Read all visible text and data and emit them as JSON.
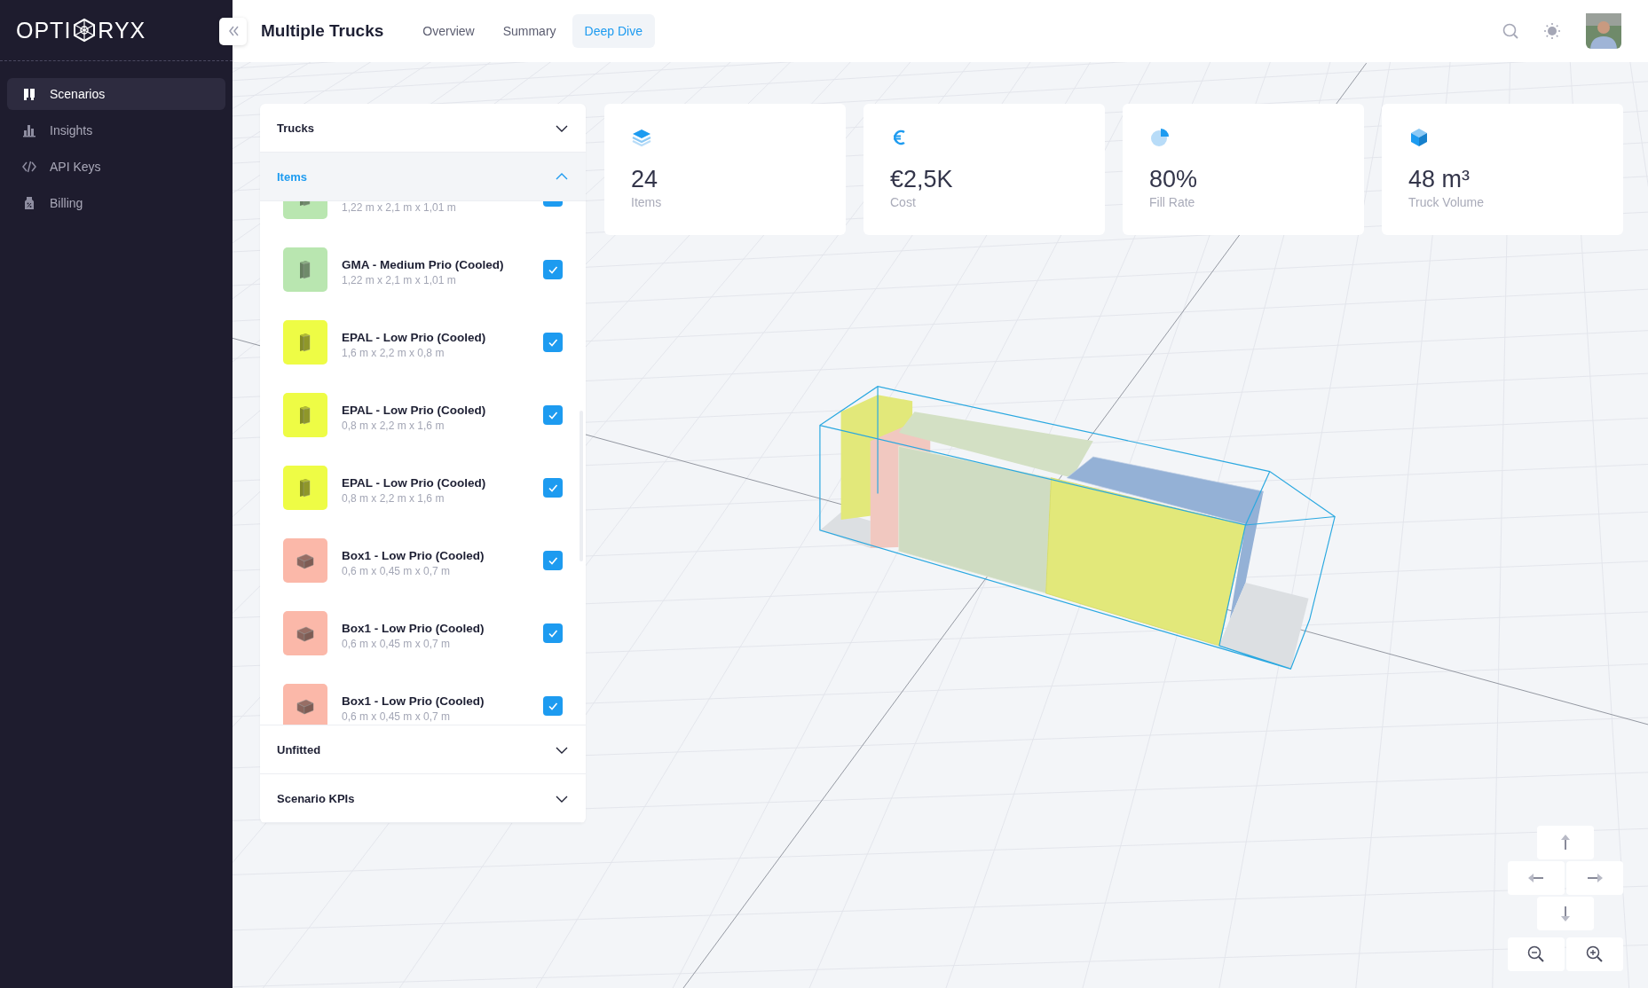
{
  "sidebar": {
    "logo": {
      "left": "OPTI",
      "right": "RYX"
    },
    "items": [
      {
        "kind": "scenarios",
        "label": "Scenarios",
        "selected": true
      },
      {
        "kind": "insights",
        "label": "Insights",
        "selected": false
      },
      {
        "kind": "api",
        "label": "API Keys",
        "selected": false
      },
      {
        "kind": "billing",
        "label": "Billing",
        "selected": false
      }
    ]
  },
  "header": {
    "title": "Multiple Trucks",
    "tabs": [
      {
        "label": "Overview",
        "selected": false
      },
      {
        "label": "Summary",
        "selected": false
      },
      {
        "label": "Deep Dive",
        "selected": true
      }
    ]
  },
  "panel": {
    "sections": [
      {
        "title": "Trucks",
        "expanded": false
      },
      {
        "title": "Items",
        "expanded": true,
        "items": [
          {
            "kind": "pallet",
            "dims": "1,22 m x 2,1 m x 1,01 m",
            "color": "#b9e6b0",
            "checked": true
          },
          {
            "kind": "pallet",
            "title": "GMA - Medium Prio (Cooled)",
            "dims": "1,22 m x 2,1 m x 1,01 m",
            "color": "#b9e6b0",
            "checked": true
          },
          {
            "kind": "pallet",
            "title": "EPAL - Low Prio (Cooled)",
            "dims": "1,6 m x 2,2 m x 0,8 m",
            "color": "#eefc45",
            "checked": true
          },
          {
            "kind": "pallet",
            "title": "EPAL - Low Prio (Cooled)",
            "dims": "0,8 m x 2,2 m x 1,6 m",
            "color": "#eefc45",
            "checked": true
          },
          {
            "kind": "pallet",
            "title": "EPAL - Low Prio (Cooled)",
            "dims": "0,8 m x 2,2 m x 1,6 m",
            "color": "#eefc45",
            "checked": true
          },
          {
            "kind": "box",
            "title": "Box1 - Low Prio (Cooled)",
            "dims": "0,6 m x 0,45 m x 0,7 m",
            "color": "#fbb8a9",
            "checked": true
          },
          {
            "kind": "box",
            "title": "Box1 - Low Prio (Cooled)",
            "dims": "0,6 m x 0,45 m x 0,7 m",
            "color": "#fbb8a9",
            "checked": true
          },
          {
            "kind": "box",
            "title": "Box1 - Low Prio (Cooled)",
            "dims": "0,6 m x 0,45 m x 0,7 m",
            "color": "#fbb8a9",
            "checked": true
          }
        ]
      },
      {
        "title": "Unfitted",
        "expanded": false
      },
      {
        "title": "Scenario KPIs",
        "expanded": false
      }
    ]
  },
  "kpis": [
    {
      "kind": "items",
      "value": "24",
      "label": "Items"
    },
    {
      "kind": "cost",
      "value": "€2,5K",
      "label": "Cost"
    },
    {
      "kind": "fill",
      "value": "80%",
      "label": "Fill Rate"
    },
    {
      "kind": "volume",
      "value": "48 m³",
      "label": "Truck Volume"
    }
  ]
}
